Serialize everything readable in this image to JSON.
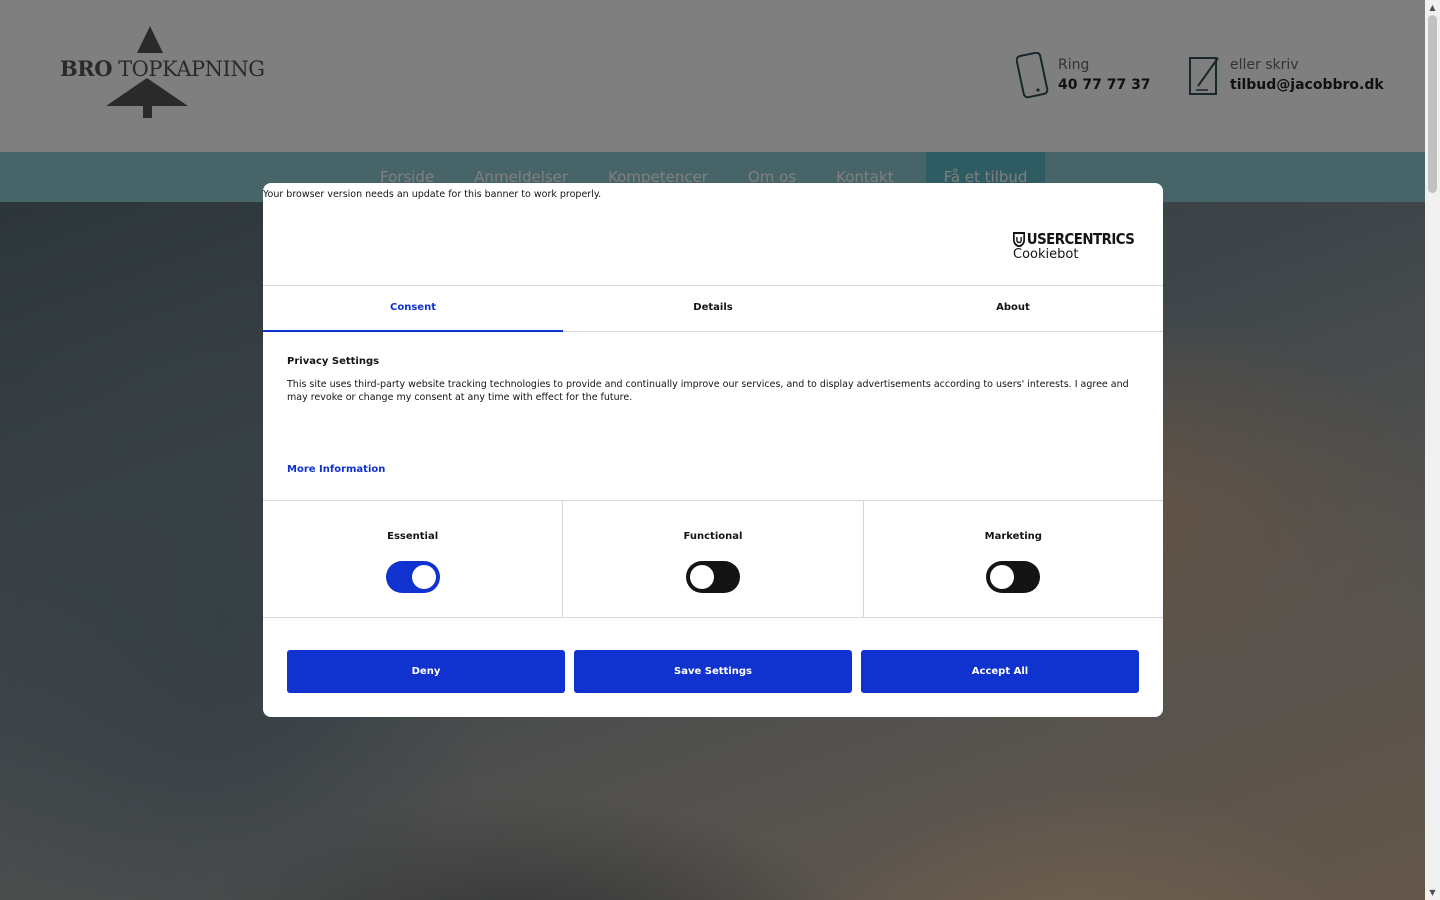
{
  "site": {
    "logo": {
      "bold": "BRO",
      "light": " TOPKAPNING"
    },
    "contact": {
      "phone_label": "Ring",
      "phone_value": "40 77 77 37",
      "mail_label": "eller skriv",
      "mail_value": "tilbud@jacobbro.dk"
    },
    "nav": {
      "items": [
        "Forside",
        "Anmeldelser",
        "Kompetencer",
        "Om os",
        "Kontakt"
      ],
      "cta": "Få et tilbud"
    }
  },
  "cookie_dialog": {
    "browser_note": "Your browser version needs an update for this banner to work properly.",
    "brand": {
      "top": "USERCENTRICS",
      "bottom": "Cookiebot"
    },
    "tabs": [
      {
        "label": "Consent",
        "active": true
      },
      {
        "label": "Details",
        "active": false
      },
      {
        "label": "About",
        "active": false
      }
    ],
    "privacy": {
      "title": "Privacy Settings",
      "text": "This site uses third-party website tracking technologies to provide and continually improve our services, and to display advertisements according to users' interests. I agree and may revoke or change my consent at any time with effect for the future.",
      "more_link": "More Information"
    },
    "categories": [
      {
        "label": "Essential",
        "enabled": true
      },
      {
        "label": "Functional",
        "enabled": false
      },
      {
        "label": "Marketing",
        "enabled": false
      }
    ],
    "buttons": {
      "deny": "Deny",
      "save": "Save Settings",
      "accept": "Accept All"
    }
  },
  "colors": {
    "accent": "#1032cf",
    "nav_bg": "#8fc9d3",
    "nav_cta_bg": "#5fb8c4"
  }
}
